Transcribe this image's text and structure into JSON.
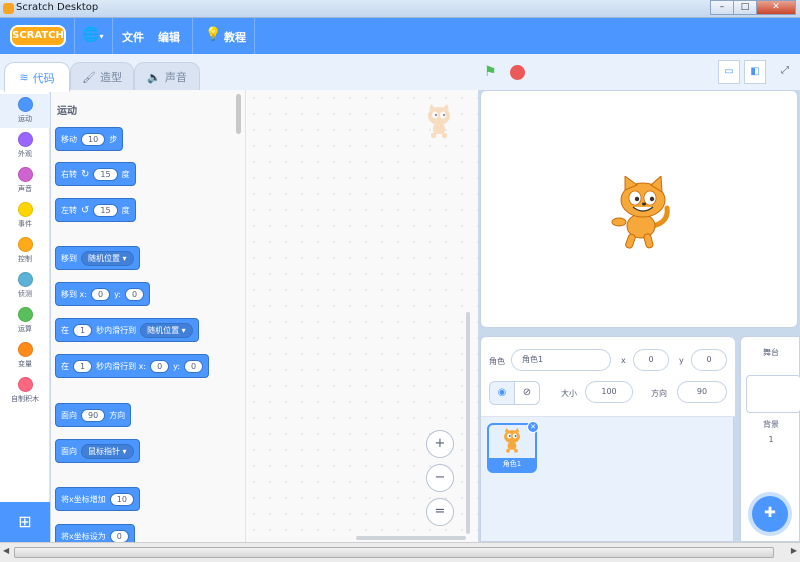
{
  "window": {
    "title": "Scratch Desktop",
    "controls": [
      "–",
      "□",
      "✕"
    ]
  },
  "menubar": {
    "logo": "SCRATCH",
    "language_icon": "globe-icon",
    "file": "文件",
    "edit": "编辑",
    "tutorials": "教程"
  },
  "tabs": [
    {
      "label": "代码",
      "icon": "code-icon",
      "active": true
    },
    {
      "label": "造型",
      "icon": "brush-icon",
      "active": false
    },
    {
      "label": "声音",
      "icon": "speaker-icon",
      "active": false
    }
  ],
  "categories": [
    {
      "label": "运动",
      "color": "#4c97ff"
    },
    {
      "label": "外观",
      "color": "#9966ff"
    },
    {
      "label": "声音",
      "color": "#cf63cf"
    },
    {
      "label": "事件",
      "color": "#ffd500"
    },
    {
      "label": "控制",
      "color": "#ffab19"
    },
    {
      "label": "侦测",
      "color": "#5cb1d6"
    },
    {
      "label": "运算",
      "color": "#59c059"
    },
    {
      "label": "变量",
      "color": "#ff8c1a"
    },
    {
      "label": "自制积木",
      "color": "#ff6680"
    }
  ],
  "palette": {
    "section_title": "运动",
    "blocks": {
      "move": {
        "a": "移动",
        "v": "10",
        "b": "步"
      },
      "turn_right": {
        "a": "右转",
        "v": "15",
        "b": "度"
      },
      "turn_left": {
        "a": "左转",
        "v": "15",
        "b": "度"
      },
      "goto": {
        "a": "移到",
        "dd": "随机位置"
      },
      "goto_xy": {
        "a": "移到 x:",
        "x": "0",
        "b": "y:",
        "y": "0"
      },
      "glide": {
        "a": "在",
        "v": "1",
        "b": "秒内滑行到",
        "dd": "随机位置"
      },
      "glide_xy": {
        "a": "在",
        "v": "1",
        "b": "秒内滑行到 x:",
        "x": "0",
        "c": "y:",
        "y": "0"
      },
      "point_dir": {
        "a": "面向",
        "v": "90",
        "b": "方向"
      },
      "point_towards": {
        "a": "面向",
        "dd": "鼠标指针"
      },
      "change_x": {
        "a": "将x坐标增加",
        "v": "10"
      },
      "set_x": {
        "a": "将x坐标设为",
        "v": "0"
      }
    }
  },
  "workspace": {
    "zoom_in": "+",
    "zoom_out": "−",
    "zoom_reset": "="
  },
  "stage_header": {
    "flag_icon": "green-flag-icon",
    "stop_icon": "stop-icon"
  },
  "sprite_info": {
    "sprite_label": "角色",
    "sprite_name": "角色1",
    "x_label": "x",
    "x_value": "0",
    "y_label": "y",
    "y_value": "0",
    "size_label": "大小",
    "size_value": "100",
    "direction_label": "方向",
    "direction_value": "90"
  },
  "sprite_list": {
    "tile_name": "角色1"
  },
  "stage_pane": {
    "title": "舞台",
    "backdrops_label": "背景",
    "backdrops_count": "1"
  }
}
